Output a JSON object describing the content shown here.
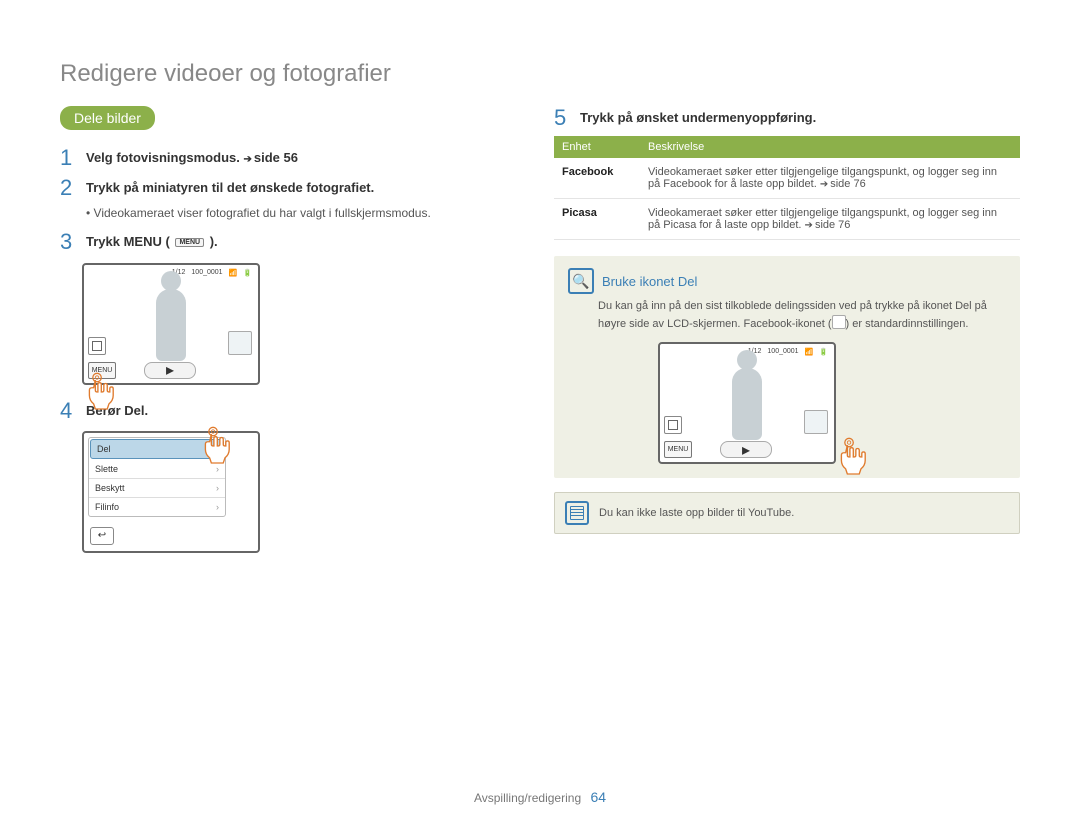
{
  "title": "Redigere videoer og fotografier",
  "pill": "Dele bilder",
  "steps": [
    {
      "num": "1",
      "text_a": "Velg fotovisningsmodus.",
      "text_b": "side 56"
    },
    {
      "num": "2",
      "text_a": "Trykk på miniatyren til det ønskede fotografiet."
    },
    {
      "bullet": "Videokameraet viser fotografiet du har valgt i fullskjermsmodus."
    },
    {
      "num": "3",
      "text_a": "Trykk MENU (",
      "text_b": ")."
    },
    {
      "num": "4",
      "text_a": "Berør Del."
    },
    {
      "num": "5",
      "text_a": "Trykk på ønsket undermenyoppføring."
    }
  ],
  "lcd": {
    "counter": "1/12",
    "filecode": "100_0001",
    "menu_label": "MENU"
  },
  "menuList": [
    "Del",
    "Slette",
    "Beskytt",
    "Filinfo"
  ],
  "table": {
    "head": [
      "Enhet",
      "Beskrivelse"
    ],
    "rows": [
      {
        "unit": "Facebook",
        "desc": "Videokameraet søker etter tilgjengelige tilgangspunkt, og logger seg inn på Facebook for å laste opp bildet. ",
        "link": "side 76"
      },
      {
        "unit": "Picasa",
        "desc": "Videokameraet søker etter tilgjengelige tilgangspunkt, og logger seg inn på Picasa for å laste opp bildet. ",
        "link": "side 76"
      }
    ]
  },
  "panel": {
    "title": "Bruke ikonet Del",
    "text_a": "Du kan gå inn på den sist tilkoblede delingssiden ved på trykke på ikonet Del på høyre side av LCD-skjermen. Facebook-ikonet (",
    "text_b": ") er standardinnstillingen."
  },
  "note": "Du kan ikke laste opp bilder til YouTube.",
  "footer": {
    "section": "Avspilling/redigering",
    "page": "64"
  },
  "menu_chip": "MENU"
}
